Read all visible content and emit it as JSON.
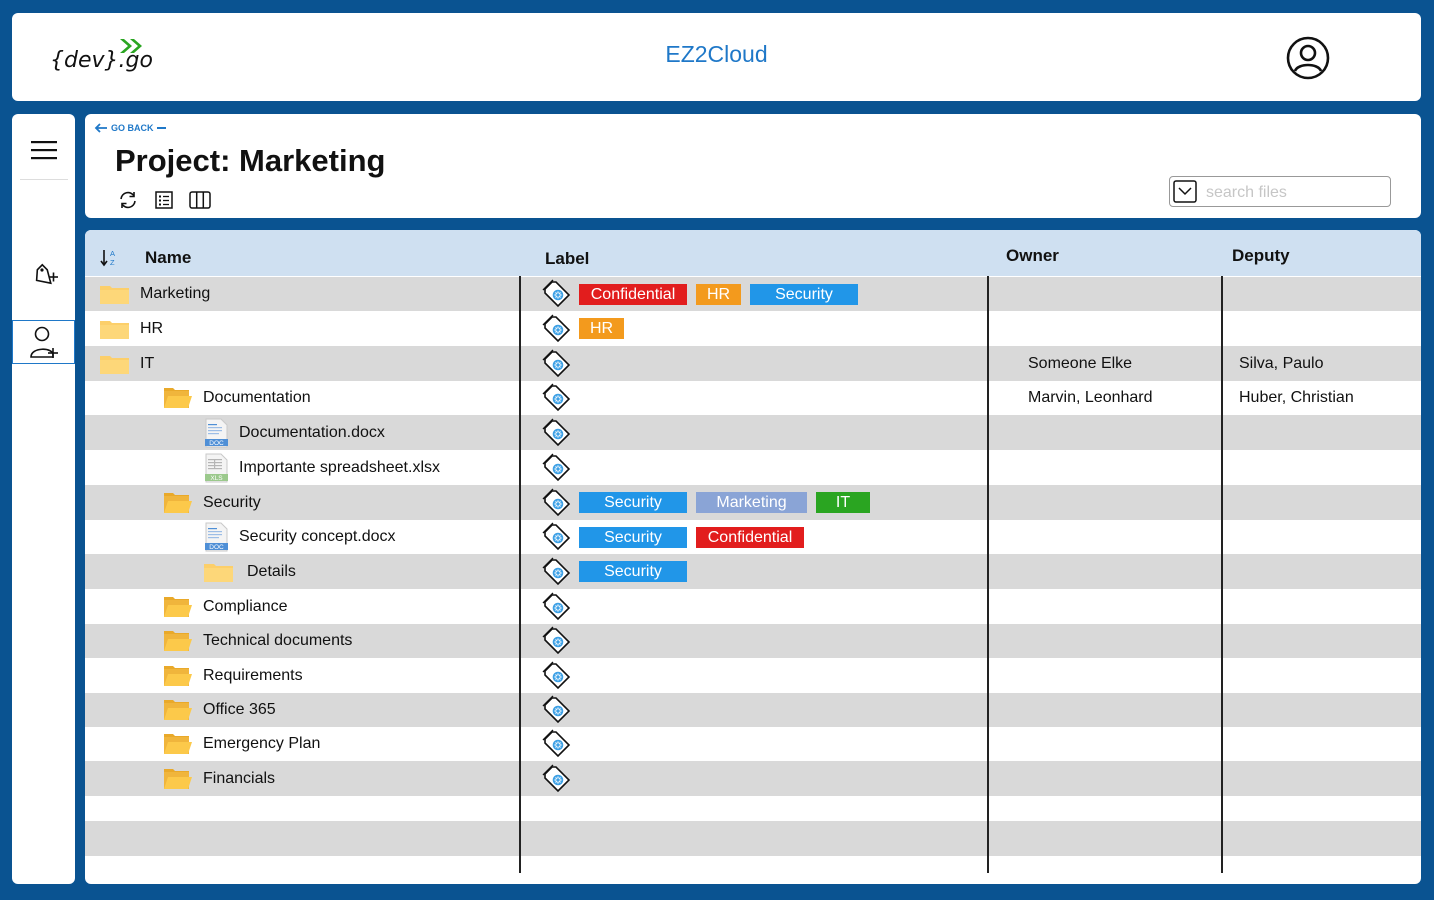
{
  "app": {
    "logo_text": "{dev}.go",
    "title": "EZ2Cloud"
  },
  "header": {
    "go_back": "GO BACK",
    "page_title": "Project: Marketing",
    "search_placeholder": "search files"
  },
  "table": {
    "columns": {
      "name": "Name",
      "label": "Label",
      "owner": "Owner",
      "deputy": "Deputy"
    },
    "rows": [
      {
        "name": "Marketing",
        "type": "folder",
        "level": 0,
        "labels": [
          "Confidential",
          "HR",
          "Security"
        ],
        "owner": "",
        "deputy": ""
      },
      {
        "name": "HR",
        "type": "folder",
        "level": 0,
        "labels": [
          "HR"
        ],
        "owner": "",
        "deputy": ""
      },
      {
        "name": "IT",
        "type": "folder",
        "level": 0,
        "labels": [],
        "owner": "Someone Elke",
        "deputy": "Silva, Paulo"
      },
      {
        "name": "Documentation",
        "type": "folder-open",
        "level": 1,
        "labels": [],
        "owner": "Marvin, Leonhard",
        "deputy": "Huber, Christian"
      },
      {
        "name": "Documentation.docx",
        "type": "doc",
        "level": 2,
        "labels": [],
        "owner": "",
        "deputy": ""
      },
      {
        "name": "Importante spreadsheet.xlsx",
        "type": "xls",
        "level": 2,
        "labels": [],
        "owner": "",
        "deputy": ""
      },
      {
        "name": "Security",
        "type": "folder-open",
        "level": 1,
        "labels": [
          "Security",
          "Marketing",
          "IT"
        ],
        "owner": "",
        "deputy": ""
      },
      {
        "name": "Security concept.docx",
        "type": "doc",
        "level": 2,
        "labels": [
          "Security",
          "Confidential"
        ],
        "owner": "",
        "deputy": ""
      },
      {
        "name": "Details",
        "type": "folder",
        "level": 2,
        "labels": [
          "Security"
        ],
        "owner": "",
        "deputy": ""
      },
      {
        "name": "Compliance",
        "type": "folder-open",
        "level": 1,
        "labels": [],
        "owner": "",
        "deputy": ""
      },
      {
        "name": "Technical documents",
        "type": "folder-open",
        "level": 1,
        "labels": [],
        "owner": "",
        "deputy": ""
      },
      {
        "name": "Requirements",
        "type": "folder-open",
        "level": 1,
        "labels": [],
        "owner": "",
        "deputy": ""
      },
      {
        "name": "Office 365",
        "type": "folder-open",
        "level": 1,
        "labels": [],
        "owner": "",
        "deputy": ""
      },
      {
        "name": "Emergency Plan",
        "type": "folder-open",
        "level": 1,
        "labels": [],
        "owner": "",
        "deputy": ""
      },
      {
        "name": "Financials",
        "type": "folder-open",
        "level": 1,
        "labels": [],
        "owner": "",
        "deputy": ""
      }
    ]
  },
  "label_colors": {
    "Confidential": "#e21d1d",
    "HR": "#f39a1d",
    "Security": "#2196e8",
    "Marketing": "#8aa4d6",
    "IT": "#2aa521"
  },
  "icons": {
    "menu": "hamburger-icon",
    "add_tag": "tag-plus-icon",
    "add_user": "user-plus-icon",
    "profile": "user-circle-icon",
    "refresh": "refresh-icon",
    "list_view": "list-icon",
    "column_view": "columns-icon",
    "sort": "sort-az-icon",
    "row_tag": "tag-icon"
  }
}
